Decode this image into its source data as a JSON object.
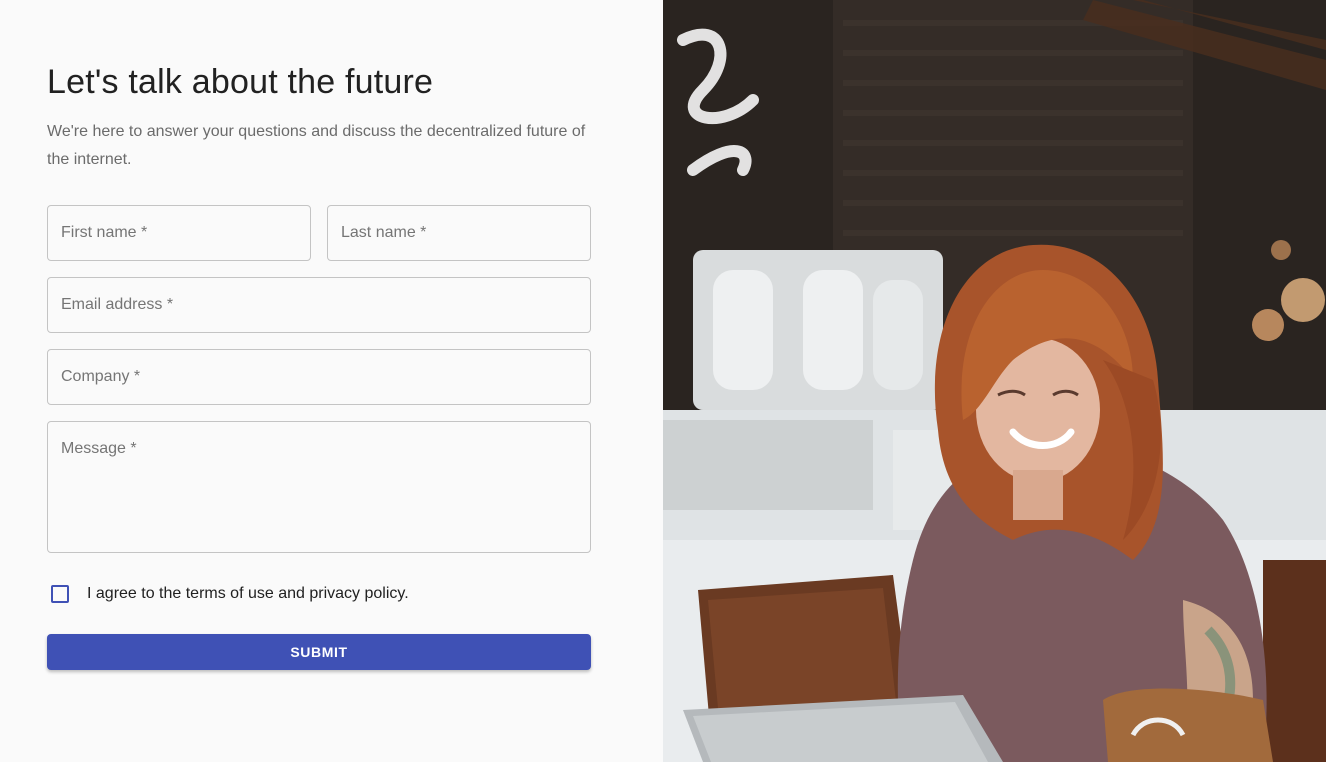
{
  "header": {
    "title": "Let's talk about the future",
    "subtitle": "We're here to answer your questions and discuss the decentralized future of the internet."
  },
  "form": {
    "first_name_label": "First name *",
    "last_name_label": "Last name *",
    "email_label": "Email address *",
    "company_label": "Company *",
    "message_label": "Message *",
    "agree_label": "I agree to the terms of use and privacy policy.",
    "agree_checked": false,
    "submit_label": "SUBMIT"
  },
  "colors": {
    "accent": "#3f51b5",
    "background": "#fafafa",
    "border": "#c4c4c4"
  },
  "hero_image": {
    "subject": "smiling woman with red hair working on a laptop in a cafe"
  }
}
